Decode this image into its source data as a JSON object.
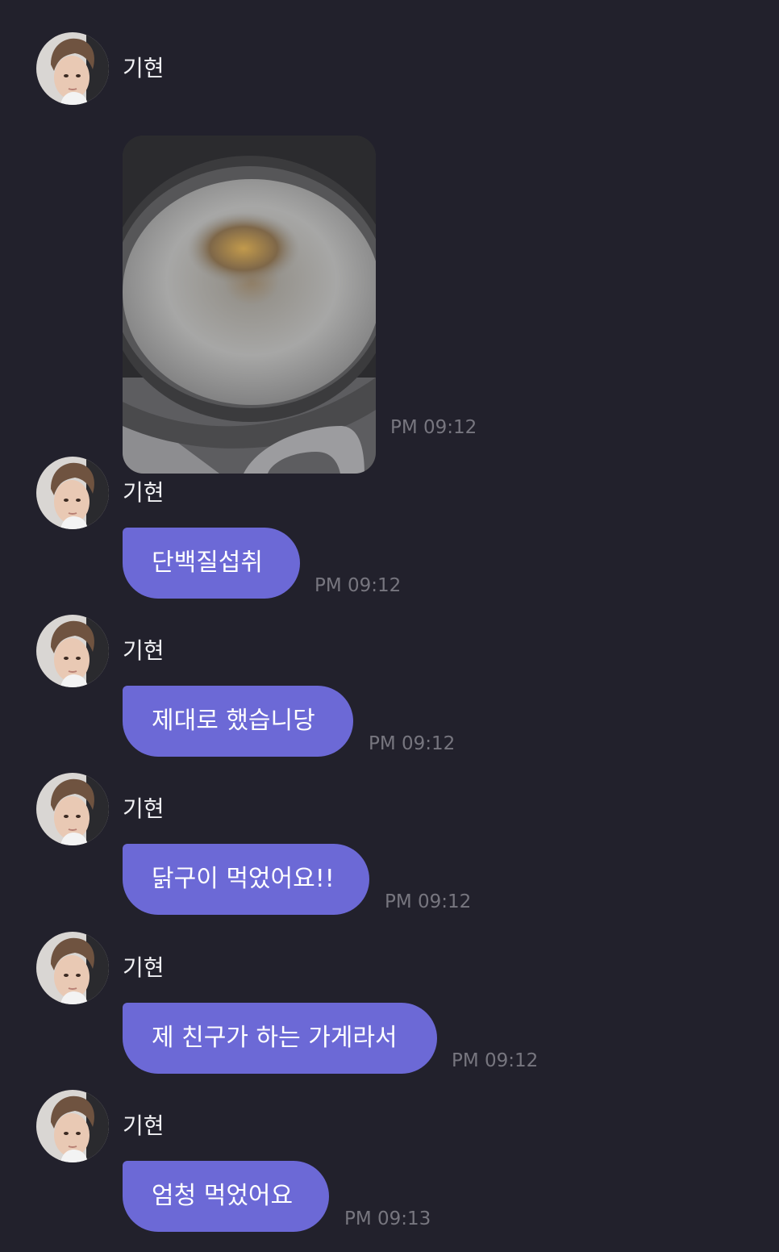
{
  "chat": {
    "messages": [
      {
        "sender": "기현",
        "type": "image",
        "image_description": "frying pan",
        "time": "PM 09:12"
      },
      {
        "sender": "기현",
        "type": "text",
        "text": "단백질섭취",
        "time": "PM 09:12"
      },
      {
        "sender": "기현",
        "type": "text",
        "text": "제대로 했습니당",
        "time": "PM 09:12"
      },
      {
        "sender": "기현",
        "type": "text",
        "text": "닭구이 먹었어요!!",
        "time": "PM 09:12"
      },
      {
        "sender": "기현",
        "type": "text",
        "text": "제 친구가 하는 가게라서",
        "time": "PM 09:12"
      },
      {
        "sender": "기현",
        "type": "text",
        "text": "엄청 먹었어요",
        "time": "PM 09:13"
      }
    ]
  },
  "colors": {
    "background": "#22212c",
    "bubble": "#6c69d6",
    "bubble_text": "#ffffff",
    "sender_text": "#f1f1f4",
    "timestamp": "#77767f"
  },
  "icons": {
    "avatar": "profile-photo"
  }
}
